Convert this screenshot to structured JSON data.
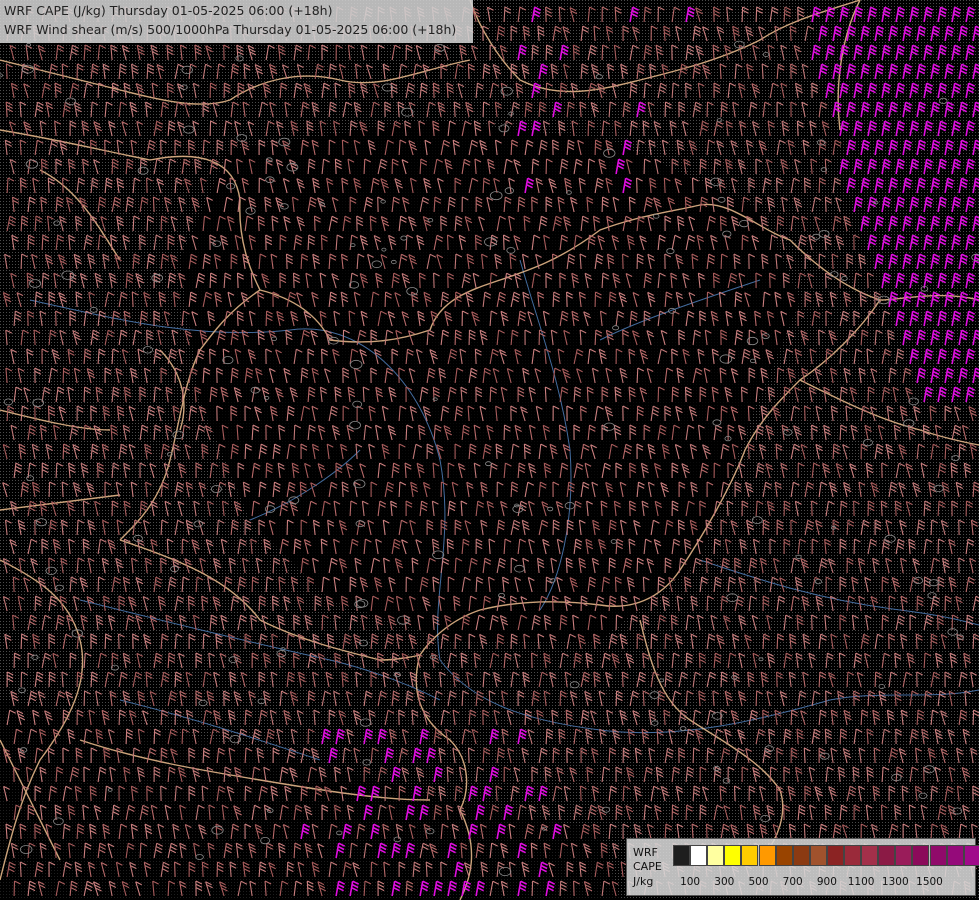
{
  "title": {
    "line1": "WRF CAPE (J/kg) Thursday 01-05-2025 06:00 (+18h)",
    "line2": "WRF Wind shear (m/s) 500/1000hPa Thursday 01-05-2025 06:00 (+18h)"
  },
  "legend": {
    "model": "WRF",
    "variable": "CAPE",
    "unit": "J/kg",
    "colors": [
      "#1e1e1e",
      "#ffffff",
      "#ffffa0",
      "#ffff00",
      "#ffcc00",
      "#ff9900",
      "#994400",
      "#8b3a12",
      "#a0522d",
      "#8b2323",
      "#9a2a3a",
      "#a3304a",
      "#8b1a45",
      "#9a1c5a",
      "#8b0a5a",
      "#900a6a",
      "#950a7a",
      "#a00a8a"
    ],
    "tick_labels": [
      "100",
      "300",
      "500",
      "700",
      "900",
      "1100",
      "1300",
      "1500"
    ]
  },
  "map": {
    "barb_colors": [
      "#b86a6a",
      "#a85c5c",
      "#c07878",
      "#cc8080",
      "#e00ee0"
    ],
    "border_color": "#f0c090",
    "river_color": "#4a78b0",
    "background": "#000000"
  }
}
